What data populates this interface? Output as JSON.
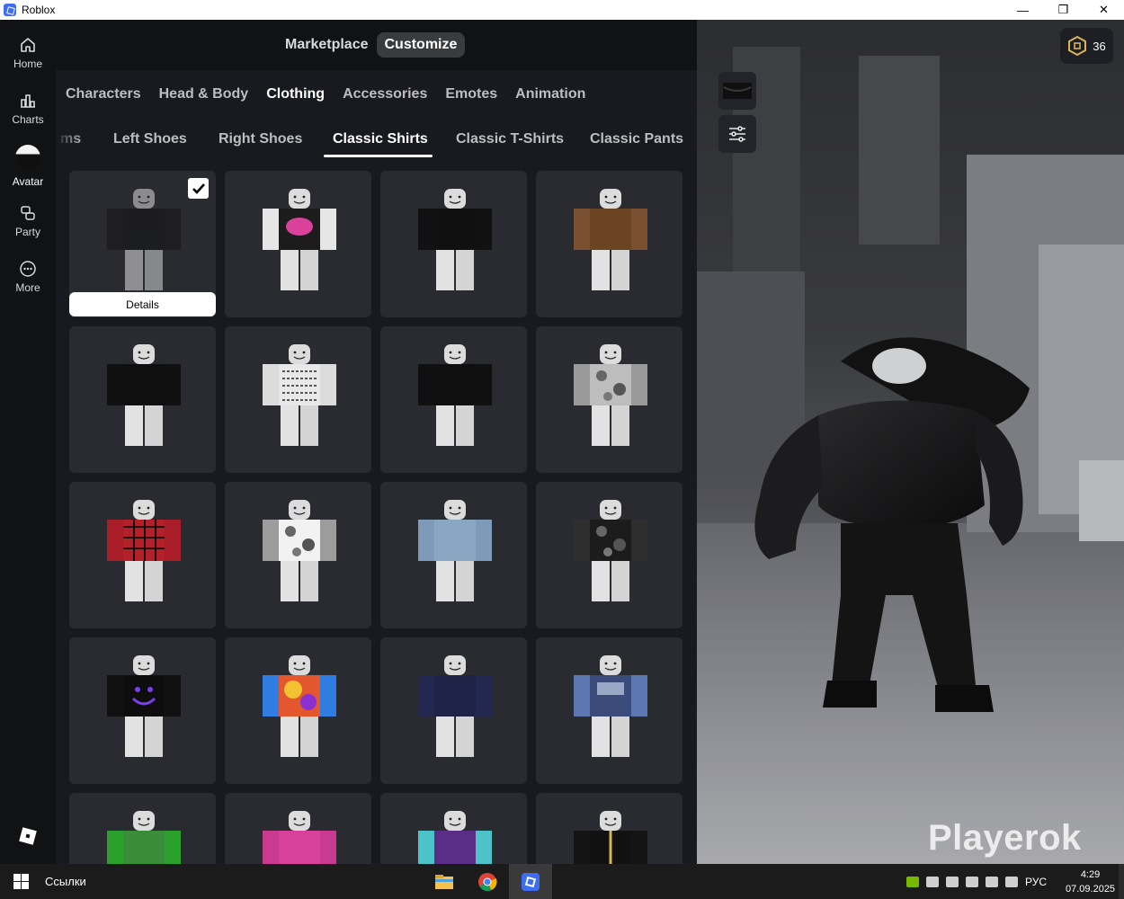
{
  "window": {
    "title": "Roblox",
    "controls": [
      "—",
      "❐",
      "✕"
    ]
  },
  "rail": {
    "items": [
      {
        "label": "Home",
        "icon": "home-icon"
      },
      {
        "label": "Charts",
        "icon": "charts-icon"
      },
      {
        "label": "Avatar",
        "icon": "avatar-icon"
      },
      {
        "label": "Party",
        "icon": "party-icon"
      },
      {
        "label": "More",
        "icon": "more-icon"
      }
    ]
  },
  "topbar": {
    "segments": [
      {
        "label": "Marketplace",
        "active": false
      },
      {
        "label": "Customize",
        "active": true
      }
    ]
  },
  "categories": [
    {
      "label": "Characters",
      "active": false
    },
    {
      "label": "Head & Body",
      "active": false
    },
    {
      "label": "Clothing",
      "active": true
    },
    {
      "label": "Accessories",
      "active": false
    },
    {
      "label": "Emotes",
      "active": false
    },
    {
      "label": "Animation",
      "active": false
    }
  ],
  "subcategories": [
    {
      "label": "ms",
      "active": false
    },
    {
      "label": "Left Shoes",
      "active": false
    },
    {
      "label": "Right Shoes",
      "active": false
    },
    {
      "label": "Classic Shirts",
      "active": true
    },
    {
      "label": "Classic T-Shirts",
      "active": false
    },
    {
      "label": "Classic Pants",
      "active": false
    }
  ],
  "grid": {
    "details_label": "Details",
    "items": [
      {
        "torso": "#121212",
        "arms": "#151515",
        "pattern": "solid",
        "equipped": true
      },
      {
        "torso": "#1c1c1c",
        "arms": "#e6e6e6",
        "pattern": "pink-print"
      },
      {
        "torso": "#101010",
        "arms": "#111111",
        "pattern": "solid"
      },
      {
        "torso": "#6b4424",
        "arms": "#7a5030",
        "pattern": "solid"
      },
      {
        "torso": "#0f0f0f",
        "arms": "#101010",
        "pattern": "solid"
      },
      {
        "torso": "#e8e8e8",
        "arms": "#dcdcdc",
        "pattern": "text-print"
      },
      {
        "torso": "#0f0f0f",
        "arms": "#101010",
        "pattern": "solid"
      },
      {
        "torso": "#bdbdbd",
        "arms": "#9a9a9a",
        "pattern": "grunge"
      },
      {
        "torso": "#b3202a",
        "arms": "#a81d27",
        "pattern": "plaid"
      },
      {
        "torso": "#f2f2f2",
        "arms": "#9c9c9c",
        "pattern": "camo"
      },
      {
        "torso": "#8aa6c2",
        "arms": "#7d9bb8",
        "pattern": "solid"
      },
      {
        "torso": "#1c1c1c",
        "arms": "#2e2e2e",
        "pattern": "grunge"
      },
      {
        "torso": "#0d0d0d",
        "arms": "#111111",
        "pattern": "purple-face"
      },
      {
        "torso": "#e4572e",
        "arms": "#2f7de1",
        "pattern": "tie-dye"
      },
      {
        "torso": "#1e2347",
        "arms": "#222850",
        "pattern": "solid"
      },
      {
        "torso": "#3b4b7a",
        "arms": "#5d77b3",
        "pattern": "armor"
      },
      {
        "torso": "#3b8c3a",
        "arms": "#2ca02c",
        "pattern": "solid"
      },
      {
        "torso": "#d8409c",
        "arms": "#c93a91",
        "pattern": "solid"
      },
      {
        "torso": "#5a2e86",
        "arms": "#4dc2c9",
        "pattern": "solid"
      },
      {
        "torso": "#111111",
        "arms": "#141414",
        "pattern": "gold-trim"
      }
    ]
  },
  "side_tools": {
    "icons": [
      "equipped-shirt-thumbnail",
      "sliders-icon"
    ]
  },
  "currency": {
    "amount": "36",
    "icon": "robux-icon"
  },
  "watermark": "Playerok",
  "taskbar": {
    "links_label": "Ссылки",
    "apps": [
      "file-explorer-icon",
      "chrome-icon",
      "roblox-icon"
    ],
    "language": "РУС",
    "time": "4:29",
    "date": "07.09.2025"
  },
  "colors": {
    "accent": "#3d6df2",
    "panel": "#191a1f",
    "card": "#2a2b31",
    "rail": "#111214"
  }
}
